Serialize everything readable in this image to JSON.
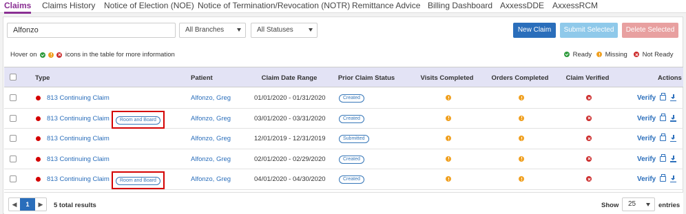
{
  "tabs": [
    {
      "label": "Claims",
      "active": true
    },
    {
      "label": "Claims History"
    },
    {
      "label": "Notice of Election (NOE)"
    },
    {
      "label": "Notice of Termination/Revocation (NOTR)"
    },
    {
      "label": "Remittance Advice"
    },
    {
      "label": "Billing Dashboard"
    },
    {
      "label": "AxxessDDE"
    },
    {
      "label": "AxxessRCM"
    }
  ],
  "filters": {
    "search_value": "Alfonzo",
    "branch": "All Branches",
    "status": "All Statuses"
  },
  "buttons": {
    "new_claim": "New Claim",
    "submit_selected": "Submit Selected",
    "delete_selected": "Delete Selected"
  },
  "hover_note": {
    "prefix": "Hover on",
    "suffix": "icons in the table for more information"
  },
  "legend": {
    "ready": "Ready",
    "missing": "Missing",
    "not_ready": "Not Ready"
  },
  "table": {
    "headers": {
      "type": "Type",
      "patient": "Patient",
      "range": "Claim Date Range",
      "prior": "Prior Claim Status",
      "visits": "Visits Completed",
      "orders": "Orders Completed",
      "verified": "Claim Verified",
      "actions": "Actions"
    },
    "rows": [
      {
        "type": "813 Continuing Claim",
        "badge": "",
        "patient": "Alfonzo, Greg",
        "range": "01/01/2020 - 01/31/2020",
        "prior": "Created",
        "visits": "missing",
        "orders": "missing",
        "verified": "not-ready",
        "verify": "Verify"
      },
      {
        "type": "813 Continuing Claim",
        "badge": "Room and Board",
        "patient": "Alfonzo, Greg",
        "range": "03/01/2020 - 03/31/2020",
        "prior": "Created",
        "visits": "missing",
        "orders": "missing",
        "verified": "not-ready",
        "verify": "Verify"
      },
      {
        "type": "813 Continuing Claim",
        "badge": "",
        "patient": "Alfonzo, Greg",
        "range": "12/01/2019 - 12/31/2019",
        "prior": "Submitted",
        "visits": "missing",
        "orders": "missing",
        "verified": "not-ready",
        "verify": "Verify"
      },
      {
        "type": "813 Continuing Claim",
        "badge": "",
        "patient": "Alfonzo, Greg",
        "range": "02/01/2020 - 02/29/2020",
        "prior": "Created",
        "visits": "missing",
        "orders": "missing",
        "verified": "not-ready",
        "verify": "Verify"
      },
      {
        "type": "813 Continuing Claim",
        "badge": "Room and Board",
        "patient": "Alfonzo, Greg",
        "range": "04/01/2020 - 04/30/2020",
        "prior": "Created",
        "visits": "missing",
        "orders": "missing",
        "verified": "not-ready",
        "verify": "Verify"
      }
    ]
  },
  "footer": {
    "current_page": "1",
    "total": "5 total results",
    "show": "Show",
    "page_size": "25",
    "entries": "entries"
  },
  "colors": {
    "accent": "#8a2f93",
    "primary": "#2a6ebb",
    "ready": "#2e9b3c",
    "missing": "#f0a020",
    "not_ready": "#cc2a2a"
  }
}
